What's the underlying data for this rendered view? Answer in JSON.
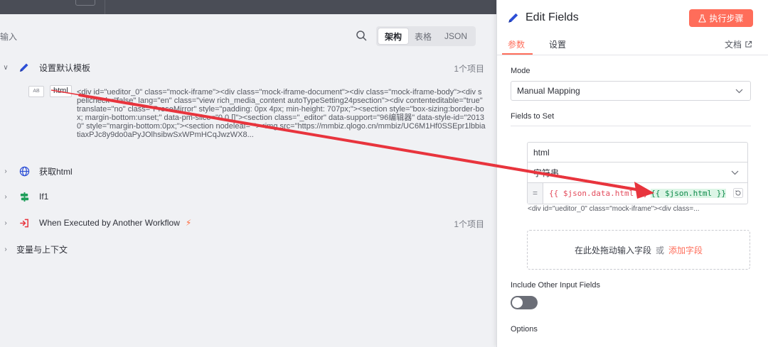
{
  "left": {
    "title": "输入",
    "view_tabs": [
      "架构",
      "表格",
      "JSON"
    ],
    "active_view": 0,
    "nodes": [
      {
        "label": "设置默认模板",
        "count": "1个项目"
      },
      {
        "label": "获取html"
      },
      {
        "label": "If1"
      },
      {
        "label": "When Executed by Another Workflow",
        "count": "1个项目"
      },
      {
        "label": "变量与上下文"
      }
    ],
    "field": {
      "type_badge": "AB",
      "name": "html",
      "value": "<div id=\"ueditor_0\" class=\"mock-iframe\"><div class=\"mock-iframe-document\"><div class=\"mock-iframe-body\"><div spellcheck=\"false\" lang=\"en\" class=\"view rich_media_content autoTypeSetting24psection\"><div contenteditable=\"true\" translate=\"no\" class=\"ProseMirror\" style=\"padding: 0px 4px; min-height: 707px;\"><section style=\"box-sizing:border-box; margin-bottom:unset;\" data-pm-slice=\"0 0 []\"><section class=\"_editor\" data-support=\"96编辑器\" data-style-id=\"20130\" style=\"margin-bottom:0px;\"><section nodeleaf=\"\"><img src=\"https://mmbiz.qlogo.cn/mmbiz/UC6M1Hf0SSEpr1lbbiatiaxPJc8y9do0aPyJOlhsibwSxWPmHCqJwzWX8..."
    }
  },
  "panel": {
    "title": "Edit Fields",
    "execute_label": "执行步骤",
    "tabs": [
      "参数",
      "设置"
    ],
    "docs_label": "文档",
    "mode_label": "Mode",
    "mode_value": "Manual Mapping",
    "fields_to_set_label": "Fields to Set",
    "field_name": "html",
    "field_type": "字符串",
    "expr_eq": "=",
    "expr_old": "{{ $json.data.html }}",
    "expr_new": "{{ $json.html }}",
    "preview": "<div id=\"ueditor_0\" class=\"mock-iframe\"><div class=...",
    "drop_text": "在此处拖动输入字段",
    "drop_or": "或",
    "add_field": "添加字段",
    "include_label": "Include Other Input Fields",
    "options_label": "Options"
  },
  "colors": {
    "accent": "#ff6d5a",
    "arrow": "#e8343d",
    "expr_red": "#e34b5c",
    "expr_green": "#0e8a4a"
  }
}
